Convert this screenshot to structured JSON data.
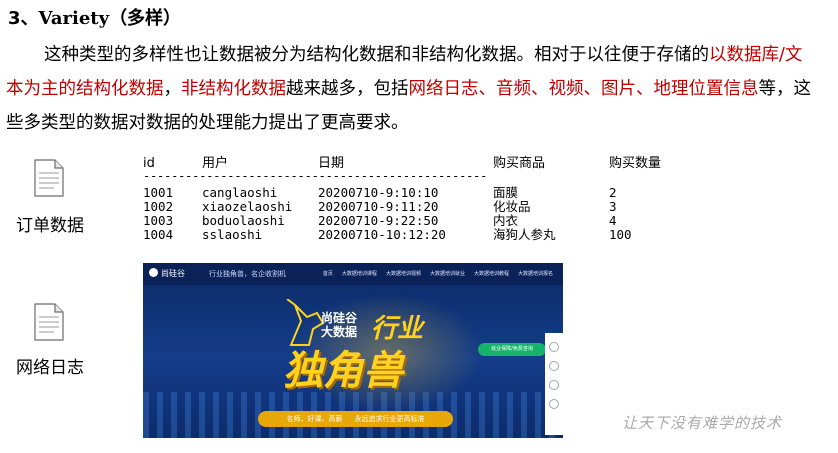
{
  "heading": {
    "number": "3、",
    "title": "Variety",
    "subtitle": "（多样）"
  },
  "paragraph": {
    "part1": "这种类型的多样性也让数据被分为结构化数据和非结构化数据。相对于以往便于存储的",
    "red1": "以数据库/文本为主的结构化数据",
    "part2": "，",
    "red2": "非结构化数据",
    "part3": "越来越多，包括",
    "red3": "网络日志、音频、视频、图片、地理位置信息",
    "part4": "等，这些多类型的数据对数据的处理能力提出了更高要求。"
  },
  "order_block": {
    "label": "订单数据",
    "icon": "document-icon",
    "columns": [
      "id",
      "用户",
      "日期",
      "购买商品",
      "购买数量"
    ],
    "separator": "-------------------------------------------------",
    "rows": [
      [
        "1001",
        "canglaoshi",
        "20200710-9:10:10",
        "面膜",
        "2"
      ],
      [
        "1002",
        "xiaozelaoshi",
        "20200710-9:11:20",
        "化妆品",
        "3"
      ],
      [
        "1003",
        "boduolaoshi",
        "20200710-9:22:50",
        "内衣",
        "4"
      ],
      [
        "1004",
        "sslaoshi",
        "20200710-10:12:20",
        "海狗人参丸",
        "100"
      ]
    ]
  },
  "weblog_block": {
    "label": "网络日志",
    "icon": "document-icon",
    "banner": {
      "logo_text": "尚硅谷",
      "tagline": "行业独角兽，名企收割机",
      "nav": [
        "首页",
        "大数据培训课程",
        "大数据培训视频",
        "大数据培训就业",
        "大数据培训教程",
        "大数据培训报名"
      ],
      "brand_small_1": "尚硅谷",
      "brand_small_2": "大数据",
      "headline_1": "行业",
      "headline_2": "独角兽",
      "chat_text": "就业保障/免费咨询",
      "footer_1": "名师、好课、高薪",
      "footer_2": "永远追求行业更高标准"
    }
  },
  "watermark": "让天下没有难学的技术",
  "colors": {
    "accent_red": "#c00000",
    "banner_blue": "#143d8a",
    "banner_gold": "#ffd21f"
  }
}
